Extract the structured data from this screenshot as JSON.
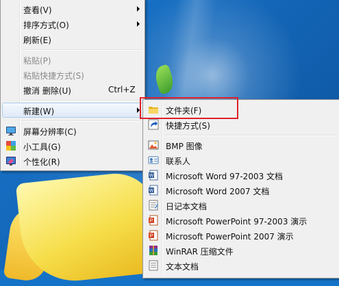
{
  "context_menu": {
    "items": [
      {
        "label": "查看(V)",
        "submenu": true
      },
      {
        "label": "排序方式(O)",
        "submenu": true
      },
      {
        "label": "刷新(E)"
      },
      {
        "label": "粘贴(P)",
        "disabled": true
      },
      {
        "label": "粘贴快捷方式(S)",
        "disabled": true
      },
      {
        "label": "撤消 删除(U)",
        "shortcut": "Ctrl+Z"
      },
      {
        "label": "新建(W)",
        "submenu": true,
        "highlighted": true
      },
      {
        "label": "屏幕分辨率(C)",
        "icon": "display-settings-icon"
      },
      {
        "label": "小工具(G)",
        "icon": "gadgets-icon"
      },
      {
        "label": "个性化(R)",
        "icon": "personalize-icon"
      }
    ]
  },
  "new_submenu": {
    "items": [
      {
        "label": "文件夹(F)",
        "icon": "folder-icon",
        "highlighted": true
      },
      {
        "label": "快捷方式(S)",
        "icon": "shortcut-icon"
      },
      {
        "label": "BMP 图像",
        "icon": "bmp-image-icon"
      },
      {
        "label": "联系人",
        "icon": "contact-icon"
      },
      {
        "label": "Microsoft Word 97-2003 文档",
        "icon": "word-doc-icon"
      },
      {
        "label": "Microsoft Word 2007 文档",
        "icon": "word-docx-icon"
      },
      {
        "label": "日记本文档",
        "icon": "journal-icon"
      },
      {
        "label": "Microsoft PowerPoint 97-2003 演示",
        "icon": "powerpoint-ppt-icon"
      },
      {
        "label": "Microsoft PowerPoint 2007 演示",
        "icon": "powerpoint-pptx-icon"
      },
      {
        "label": "WinRAR 压缩文件",
        "icon": "winrar-icon"
      },
      {
        "label": "文本文档",
        "icon": "text-document-icon"
      }
    ]
  },
  "colors": {
    "highlight_border": "#aeccec",
    "annotation_red": "#e0202a",
    "menu_bg": "#f0f0f0"
  }
}
